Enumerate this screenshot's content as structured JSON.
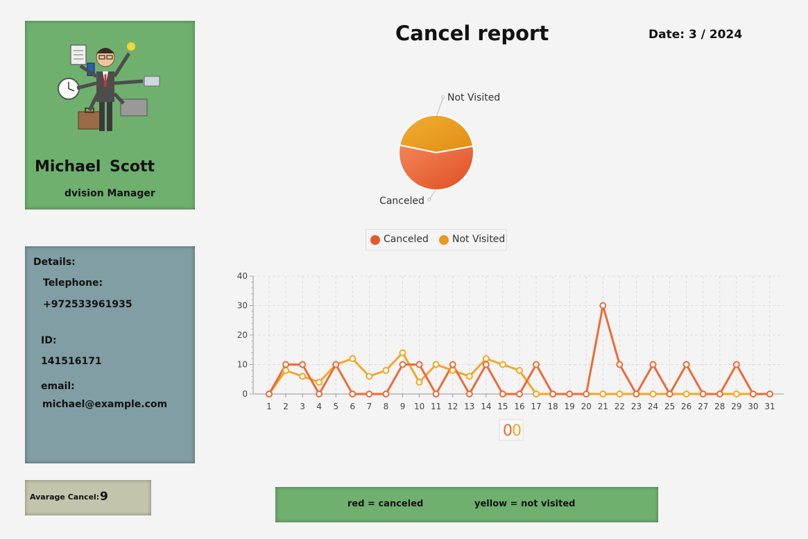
{
  "header": {
    "title": "Cancel report",
    "date": "Date: 3 / 2024"
  },
  "profile": {
    "first_name": "Michael",
    "last_name": "Scott",
    "role": "dvision Manager"
  },
  "details": {
    "heading": "Details:",
    "telephone_label": "Telephone:",
    "telephone_value": "+972533961935",
    "id_label": "ID:",
    "id_value": "141516171",
    "email_label": "email:",
    "email_value": "michael@example.com"
  },
  "average": {
    "label": "Avarage Cancel:",
    "value": "9"
  },
  "bottom_legend": {
    "red": "red = canceled",
    "yellow": "yellow = not visited"
  },
  "colors": {
    "canceled": "#ee6a35",
    "not_visited": "#f5a623",
    "profile_bg": "#6fb06f",
    "details_bg": "#809ea4",
    "average_bg": "#c4c3ac"
  },
  "chart_data": [
    {
      "type": "pie",
      "slices": [
        {
          "name": "Canceled",
          "value": 56
        },
        {
          "name": "Not Visited",
          "value": 44
        }
      ],
      "labels": [
        "Canceled",
        "Not Visited"
      ],
      "legend": [
        "Canceled",
        "Not Visited"
      ],
      "legend_position": "below"
    },
    {
      "type": "line",
      "x": [
        1,
        2,
        3,
        4,
        5,
        6,
        7,
        8,
        9,
        10,
        11,
        12,
        13,
        14,
        15,
        16,
        17,
        18,
        19,
        20,
        21,
        22,
        23,
        24,
        25,
        26,
        27,
        28,
        29,
        30,
        31
      ],
      "series": [
        {
          "name": "Canceled",
          "values": [
            0,
            10,
            10,
            0,
            10,
            0,
            0,
            0,
            10,
            10,
            0,
            10,
            0,
            10,
            0,
            0,
            10,
            0,
            0,
            0,
            30,
            10,
            0,
            10,
            0,
            10,
            0,
            0,
            10,
            0,
            0
          ]
        },
        {
          "name": "Not Visited",
          "values": [
            0,
            8,
            6,
            4,
            10,
            12,
            6,
            8,
            14,
            4,
            10,
            8,
            6,
            12,
            10,
            8,
            0,
            0,
            0,
            0,
            0,
            0,
            0,
            0,
            0,
            0,
            0,
            0,
            0,
            0,
            0
          ]
        }
      ],
      "ylim": [
        0,
        40
      ],
      "yticks": [
        0,
        10,
        20,
        30,
        40
      ],
      "grid": true,
      "bottom_marker": "00"
    }
  ]
}
